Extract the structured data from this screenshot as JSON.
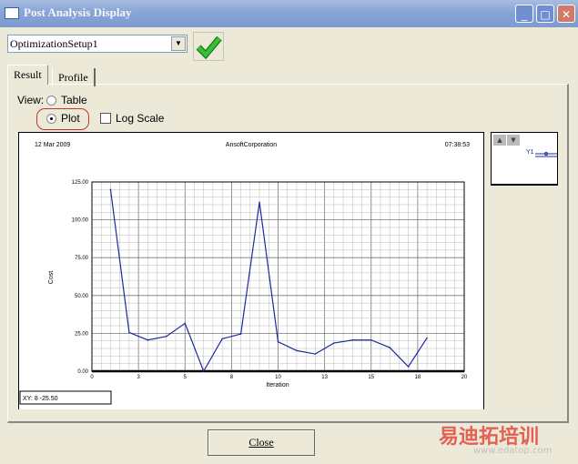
{
  "window": {
    "title": "Post Analysis Display",
    "minimize": "_",
    "maximize": "□",
    "close": "✕"
  },
  "setup_select": {
    "value": "OptimizationSetup1"
  },
  "tabs": [
    {
      "label": "Result",
      "active": true
    },
    {
      "label": "Profile",
      "active": false
    }
  ],
  "view": {
    "label": "View:",
    "table_label": "Table",
    "plot_label": "Plot",
    "selected": "Plot",
    "log_scale_label": "Log Scale",
    "log_scale_checked": false
  },
  "plot_header": {
    "date": "12 Mar 2009",
    "company": "AnsoftCorporation",
    "time": "07:38:53"
  },
  "xy_readout": "XY: 8 -25.50",
  "legend": {
    "up": "▲",
    "down": "▼",
    "series_label": "Y1"
  },
  "close_button": "Close",
  "watermark": {
    "text": "易迪拓培训",
    "url": "www.edatop.com"
  },
  "colors": {
    "series": "#1f2a9c",
    "highlight_ring": "#c0392b",
    "ok_check": "#2fb52f"
  },
  "chart_data": {
    "type": "line",
    "title": "",
    "xlabel": "Iteration",
    "ylabel": "Cost",
    "xlim": [
      0,
      20
    ],
    "ylim": [
      0,
      125
    ],
    "xticks": [
      0,
      2.5,
      5,
      7.5,
      10,
      12.5,
      15,
      17.5,
      20
    ],
    "xtick_labels": [
      "0",
      "3",
      "5",
      "8",
      "10",
      "13",
      "15",
      "18",
      "20"
    ],
    "yticks": [
      0,
      25,
      50,
      75,
      100,
      125
    ],
    "ytick_labels": [
      "0.00",
      "25.00",
      "50.00",
      "75.00",
      "100.00",
      "125.00"
    ],
    "grid": true,
    "series": [
      {
        "name": "Y1",
        "x": [
          1,
          2,
          3,
          4,
          5,
          6,
          7,
          8,
          9,
          10,
          11,
          12,
          13,
          14,
          15,
          16,
          17,
          18
        ],
        "y": [
          120,
          25.6,
          20.6,
          23,
          31.6,
          0,
          21.4,
          24.6,
          111.6,
          19.4,
          13.6,
          11.4,
          18.6,
          20.6,
          20.6,
          15.6,
          3,
          22
        ]
      }
    ]
  }
}
